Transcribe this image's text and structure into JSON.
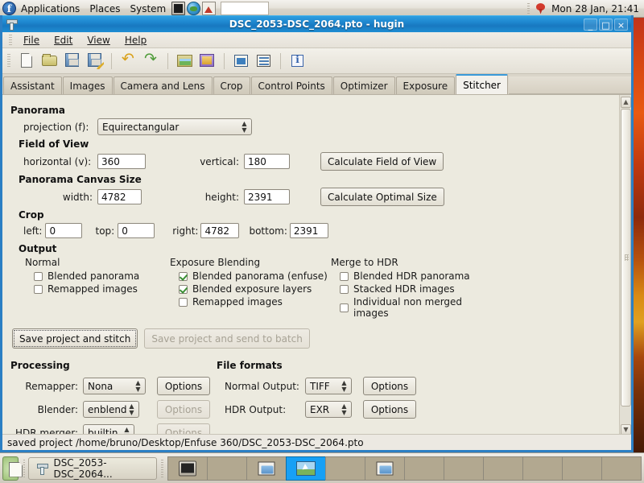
{
  "desktop_panel": {
    "menus": [
      "Applications",
      "Places",
      "System"
    ],
    "launchers": [
      {
        "name": "terminal-icon",
        "label": "Terminal"
      },
      {
        "name": "web-browser-icon",
        "label": "Web Browser"
      },
      {
        "name": "chart-icon",
        "label": "Charts"
      }
    ],
    "clock": "Mon 28 Jan, 21:41",
    "tray_icon": "gem-icon"
  },
  "window": {
    "title": "DSC_2053-DSC_2064.pto - hugin",
    "icon": "hugin-icon",
    "buttons": {
      "minimize": "_",
      "maximize": "□",
      "close": "×"
    }
  },
  "menubar": [
    "File",
    "Edit",
    "View",
    "Help"
  ],
  "toolbar": [
    {
      "name": "new-project-icon",
      "label": "New project"
    },
    {
      "name": "open-project-icon",
      "label": "Open project"
    },
    {
      "name": "save-project-icon",
      "label": "Save project"
    },
    {
      "name": "save-project-as-icon",
      "label": "Save project as"
    },
    {
      "name": "undo-icon",
      "label": "Undo"
    },
    {
      "name": "redo-icon",
      "label": "Redo"
    },
    {
      "name": "add-images-icon",
      "label": "Add images"
    },
    {
      "name": "add-image-series-icon",
      "label": "Add time-series of images"
    },
    {
      "name": "preview-panorama-icon",
      "label": "Show preview window"
    },
    {
      "name": "fast-preview-icon",
      "label": "Show the OpenGL preview window"
    },
    {
      "name": "about-icon",
      "label": "About"
    }
  ],
  "tabs": [
    {
      "label": "Assistant",
      "active": false
    },
    {
      "label": "Images",
      "active": false
    },
    {
      "label": "Camera and Lens",
      "active": false
    },
    {
      "label": "Crop",
      "active": false
    },
    {
      "label": "Control Points",
      "active": false
    },
    {
      "label": "Optimizer",
      "active": false
    },
    {
      "label": "Exposure",
      "active": false
    },
    {
      "label": "Stitcher",
      "active": true
    }
  ],
  "stitcher": {
    "panorama": {
      "heading": "Panorama",
      "projection_label": "projection (f):",
      "projection_value": "Equirectangular"
    },
    "fov": {
      "heading": "Field of View",
      "horizontal_label": "horizontal (v):",
      "horizontal_value": "360",
      "vertical_label": "vertical:",
      "vertical_value": "180",
      "calc_button": "Calculate Field of View"
    },
    "canvas": {
      "heading": "Panorama Canvas Size",
      "width_label": "width:",
      "width_value": "4782",
      "height_label": "height:",
      "height_value": "2391",
      "calc_button": "Calculate Optimal Size"
    },
    "crop": {
      "heading": "Crop",
      "left_label": "left:",
      "left_value": "0",
      "top_label": "top:",
      "top_value": "0",
      "right_label": "right:",
      "right_value": "4782",
      "bottom_label": "bottom:",
      "bottom_value": "2391"
    },
    "output": {
      "heading": "Output",
      "columns": [
        {
          "title": "Normal",
          "items": [
            {
              "label": "Blended panorama",
              "checked": false
            },
            {
              "label": "Remapped images",
              "checked": false
            }
          ]
        },
        {
          "title": "Exposure Blending",
          "items": [
            {
              "label": "Blended panorama (enfuse)",
              "checked": true
            },
            {
              "label": "Blended exposure layers",
              "checked": true
            },
            {
              "label": "Remapped images",
              "checked": false
            }
          ]
        },
        {
          "title": "Merge to HDR",
          "items": [
            {
              "label": "Blended HDR panorama",
              "checked": false
            },
            {
              "label": "Stacked HDR images",
              "checked": false
            },
            {
              "label": "Individual non merged images",
              "checked": false
            }
          ]
        }
      ]
    },
    "actions": {
      "stitch_button": "Save project and stitch",
      "batch_button": "Save project and send to batch",
      "batch_disabled": true
    },
    "processing": {
      "heading": "Processing",
      "rows": [
        {
          "label": "Remapper:",
          "value": "Nona",
          "options": "Options",
          "options_disabled": false
        },
        {
          "label": "Blender:",
          "value": "enblend",
          "options": "Options",
          "options_disabled": true
        },
        {
          "label": "HDR merger:",
          "value": "builtin",
          "options": "Options",
          "options_disabled": true
        }
      ]
    },
    "fileformats": {
      "heading": "File formats",
      "rows": [
        {
          "label": "Normal Output:",
          "value": "TIFF",
          "options": "Options",
          "options_disabled": false
        },
        {
          "label": "HDR Output:",
          "value": "EXR",
          "options": "Options",
          "options_disabled": false
        }
      ]
    }
  },
  "statusbar": {
    "text": "saved project /home/bruno/Desktop/Enfuse 360/DSC_2053-DSC_2064.pto"
  },
  "taskbar": {
    "show_desktop_icon": "show-desktop-icon",
    "task_label": "DSC_2053-DSC_2064...",
    "workspaces": [
      {
        "index": 1,
        "active": false,
        "content": "terminal"
      },
      {
        "index": 2,
        "active": false,
        "content": "empty"
      },
      {
        "index": 3,
        "active": false,
        "content": "folder"
      },
      {
        "index": 4,
        "active": true,
        "content": "panorama"
      },
      {
        "index": 5,
        "active": false,
        "content": "empty"
      },
      {
        "index": 6,
        "active": false,
        "content": "folder"
      },
      {
        "index": 7,
        "active": false,
        "content": "empty"
      },
      {
        "index": 8,
        "active": false,
        "content": "empty"
      },
      {
        "index": 9,
        "active": false,
        "content": "empty"
      },
      {
        "index": 10,
        "active": false,
        "content": "empty"
      },
      {
        "index": 11,
        "active": false,
        "content": "empty"
      },
      {
        "index": 12,
        "active": false,
        "content": "empty"
      }
    ]
  },
  "colors": {
    "titlebar": "#1e87cf",
    "tab_accent": "#3a9ad9",
    "checkmark": "#3c8f35",
    "workspace_active": "#17a0f5"
  }
}
